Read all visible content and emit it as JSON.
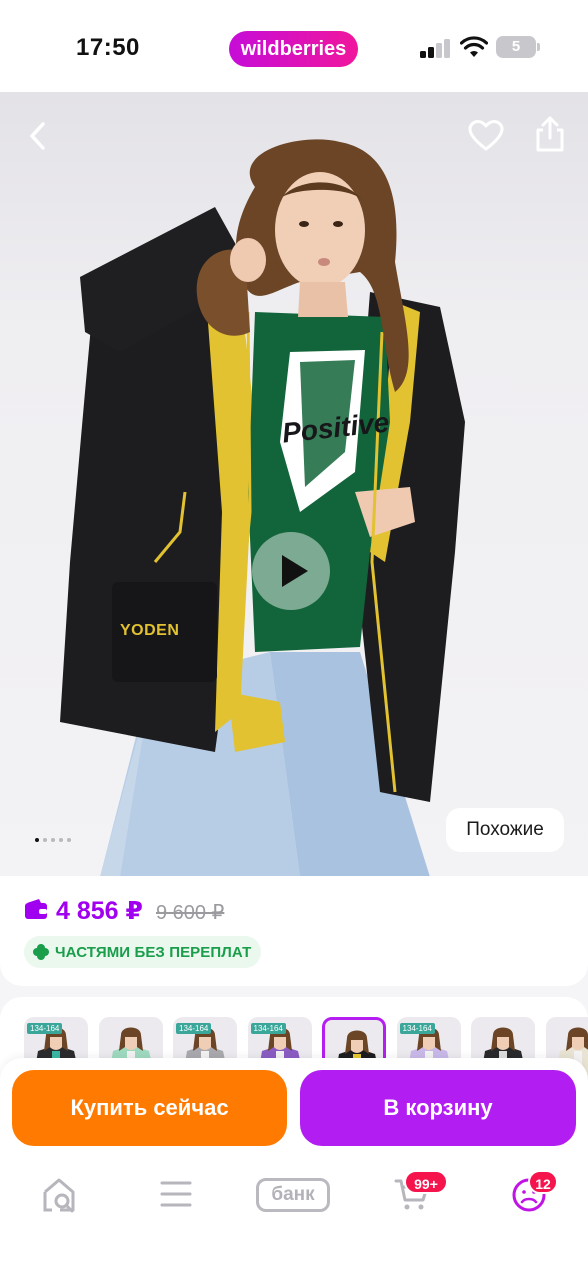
{
  "status_bar": {
    "time": "17:50",
    "brand": "wildberries",
    "battery": "5"
  },
  "product": {
    "photo_text": {
      "pocket_logo": "YODEN",
      "sweatshirt_print": "Positive"
    },
    "gallery_page_count": 5,
    "gallery_current_page": 1
  },
  "similar_label": "Похожие",
  "price": {
    "current": "4 856 ₽",
    "old": "9 600 ₽"
  },
  "installments_label": "ЧАСТЯМИ БЕЗ ПЕРЕПЛАТ",
  "color_variants": [
    {
      "jacket": "#2c2c2e",
      "accent": "#3ab7a4",
      "tag": "134-164",
      "selected": false
    },
    {
      "jacket": "#9fd9c0",
      "accent": "#f2f2f2",
      "tag": "",
      "selected": false
    },
    {
      "jacket": "#a9a9ae",
      "accent": "#f2f2f2",
      "tag": "134-164",
      "selected": false
    },
    {
      "jacket": "#8a5cc4",
      "accent": "#f2f2f2",
      "tag": "134-164",
      "selected": false
    },
    {
      "jacket": "#1d1d1f",
      "accent": "#e8c930",
      "tag": "",
      "selected": true
    },
    {
      "jacket": "#c9b9e9",
      "accent": "#f2f2f2",
      "tag": "134-164",
      "selected": false
    },
    {
      "jacket": "#2a2a2c",
      "accent": "#dedede",
      "tag": "",
      "selected": false
    },
    {
      "jacket": "#e9e3d3",
      "accent": "#f2f2f2",
      "tag": "",
      "selected": false
    }
  ],
  "actions": {
    "buy_now": "Купить сейчас",
    "add_to_cart": "В корзину"
  },
  "tab_bar": {
    "bank_label": "банк",
    "cart_badge": "99+",
    "profile_badge": "12"
  },
  "colors": {
    "brand_purple": "#b21ef2",
    "buy_orange": "#ff7a00",
    "price_purple": "#a100f0",
    "installments_green": "#1a9e4b",
    "badge_red": "#f5144c"
  },
  "icons": [
    "back-icon",
    "heart-icon",
    "share-icon",
    "play-icon",
    "wallet-icon",
    "clover-icon",
    "home-search-icon",
    "menu-icon",
    "cart-icon",
    "profile-icon"
  ]
}
